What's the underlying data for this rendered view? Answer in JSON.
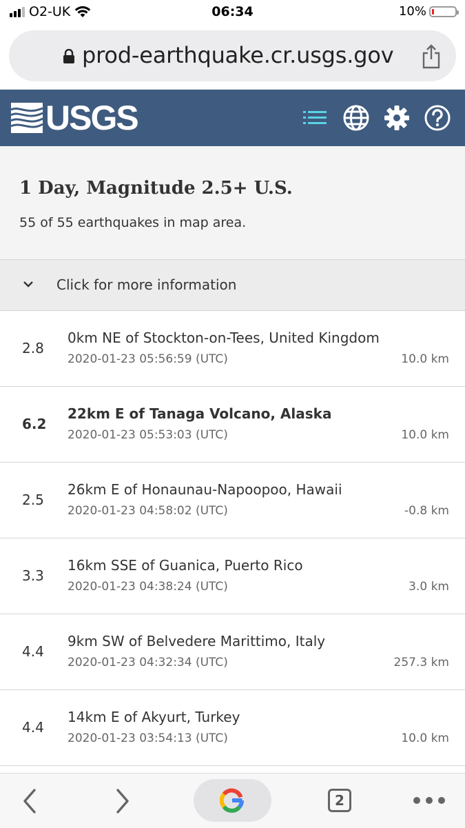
{
  "status_bar": {
    "carrier": "O2-UK",
    "time": "06:34",
    "battery_percent": "10%",
    "battery_level": 0.1
  },
  "browser": {
    "url": "prod-earthquake.cr.usgs.gov",
    "tab_count": "2"
  },
  "header": {
    "logo_text": "USGS",
    "icons": [
      "list-icon",
      "globe-icon",
      "gear-icon",
      "help-icon"
    ],
    "color": "#3f5b7f",
    "active_icon_color": "#5ad3e6"
  },
  "summary": {
    "title": "1 Day, Magnitude 2.5+ U.S.",
    "subtitle": "55 of 55 earthquakes in map area."
  },
  "more_info": {
    "label": "Click for more information"
  },
  "earthquakes": [
    {
      "mag": "2.8",
      "place": "0km NE of Stockton-on-Tees, United Kingdom",
      "time": "2020-01-23 05:56:59 (UTC)",
      "depth": "10.0 km"
    },
    {
      "mag": "6.2",
      "place": "22km E of Tanaga Volcano, Alaska",
      "time": "2020-01-23 05:53:03 (UTC)",
      "depth": "10.0 km"
    },
    {
      "mag": "2.5",
      "place": "26km E of Honaunau-Napoopoo, Hawaii",
      "time": "2020-01-23 04:58:02 (UTC)",
      "depth": "-0.8 km"
    },
    {
      "mag": "3.3",
      "place": "16km SSE of Guanica, Puerto Rico",
      "time": "2020-01-23 04:38:24 (UTC)",
      "depth": "3.0 km"
    },
    {
      "mag": "4.4",
      "place": "9km SW of Belvedere Marittimo, Italy",
      "time": "2020-01-23 04:32:34 (UTC)",
      "depth": "257.3 km"
    },
    {
      "mag": "4.4",
      "place": "14km E of Akyurt, Turkey",
      "time": "2020-01-23 03:54:13 (UTC)",
      "depth": "10.0 km"
    }
  ]
}
